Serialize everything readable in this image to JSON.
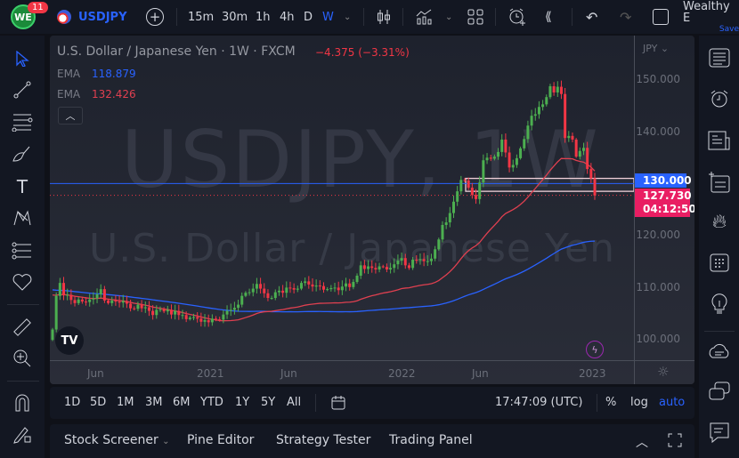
{
  "topbar": {
    "notif_count": "11",
    "symbol": "USDJPY",
    "intervals": [
      "15m",
      "30m",
      "1h",
      "4h",
      "D",
      "W"
    ],
    "active_interval": "W",
    "layout_name": "Wealthy E",
    "save_label": "Save"
  },
  "legend": {
    "title": "U.S. Dollar / Japanese Yen · 1W · FXCM",
    "change": "−4.375 (−3.31%)",
    "ema1_label": "EMA",
    "ema1_value": "118.879",
    "ema2_label": "EMA",
    "ema2_value": "132.426"
  },
  "watermark": {
    "line1": "USDJPY, 1W",
    "line2": "U.S. Dollar / Japanese Yen"
  },
  "price_axis": {
    "currency": "JPY",
    "labels": [
      "150.000",
      "140.000",
      "120.000",
      "110.000",
      "100.000"
    ],
    "hline_label": "130.000",
    "last_price": "127.730",
    "countdown": "04:12:50"
  },
  "time_axis": {
    "labels": [
      "Jun",
      "2021",
      "Jun",
      "2022",
      "Jun",
      "2023"
    ]
  },
  "rangebar": {
    "ranges": [
      "1D",
      "5D",
      "1M",
      "3M",
      "6M",
      "YTD",
      "1Y",
      "5Y",
      "All"
    ],
    "clock": "17:47:09 (UTC)",
    "percent": "%",
    "log": "log",
    "auto": "auto"
  },
  "bottompanel": {
    "tabs": [
      "Stock Screener",
      "Pine Editor",
      "Strategy Tester",
      "Trading Panel"
    ]
  },
  "colors": {
    "up": "#26a69a",
    "up_candle": "#4caf50",
    "down": "#f23645",
    "ema_blue": "#2962ff",
    "ema_red": "#e04050",
    "accent": "#2962ff",
    "last_price_bg": "#e91e63"
  },
  "chart_data": {
    "type": "candlestick",
    "title": "USDJPY, 1W (FXCM)",
    "start": "2020-03",
    "interval": "1W",
    "ylim": [
      96,
      155
    ],
    "ema_last": {
      "blue": 118.879,
      "red": 132.426
    },
    "horizontal_line": 130.0,
    "zone": [
      128.5,
      131.0
    ],
    "last_price": 127.73,
    "closes": [
      101.8,
      108.3,
      110.8,
      108.4,
      108.5,
      107.5,
      106.9,
      107.6,
      107.2,
      107.1,
      107.6,
      107.8,
      108.6,
      109.6,
      107.4,
      106.9,
      107.4,
      107.2,
      107.0,
      107.3,
      106.8,
      105.9,
      105.8,
      106.6,
      105.9,
      106.1,
      105.4,
      104.6,
      105.6,
      105.7,
      105.3,
      105.6,
      104.7,
      105.4,
      104.6,
      104.6,
      103.8,
      104.1,
      104.2,
      103.9,
      103.3,
      103.6,
      103.2,
      103.9,
      103.8,
      103.7,
      104.7,
      105.4,
      105.6,
      106.0,
      106.6,
      108.3,
      108.9,
      109.0,
      109.7,
      110.6,
      109.7,
      108.8,
      107.9,
      107.9,
      109.0,
      109.3,
      108.9,
      109.9,
      109.8,
      109.5,
      109.7,
      110.8,
      111.1,
      110.5,
      110.1,
      110.3,
      110.2,
      109.5,
      109.6,
      109.8,
      109.9,
      109.4,
      110.1,
      110.7,
      110.0,
      111.0,
      112.2,
      114.2,
      113.5,
      114.0,
      113.7,
      113.4,
      114.0,
      113.9,
      113.4,
      113.7,
      114.4,
      115.1,
      115.6,
      114.2,
      113.7,
      115.3,
      115.2,
      115.4,
      115.0,
      115.0,
      115.5,
      117.3,
      119.2,
      122.0,
      122.5,
      124.3,
      126.5,
      128.5,
      130.7,
      130.6,
      129.2,
      127.8,
      127.0,
      130.2,
      134.5,
      135.0,
      134.8,
      135.2,
      136.1,
      138.5,
      136.0,
      133.1,
      133.6,
      134.9,
      136.8,
      138.6,
      141.2,
      143.1,
      143.4,
      144.8,
      145.3,
      146.7,
      148.8,
      147.6,
      148.7,
      147.3,
      138.8,
      139.2,
      138.5,
      135.2,
      136.3,
      136.9,
      132.8,
      131.0,
      127.7
    ]
  }
}
